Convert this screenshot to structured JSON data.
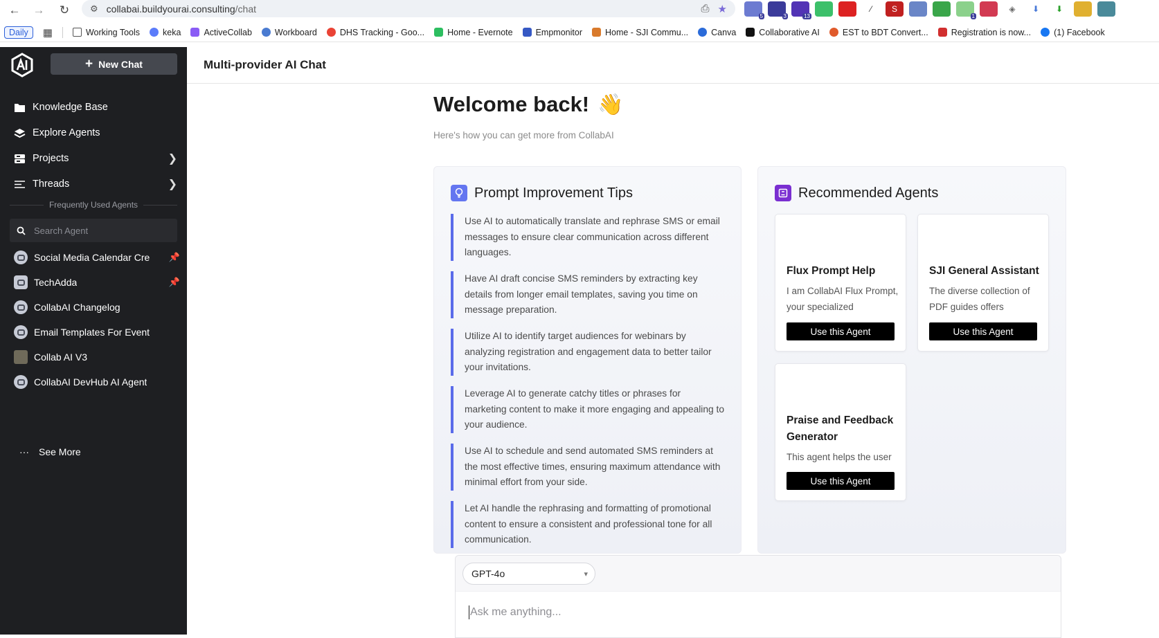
{
  "browser": {
    "url_host": "collabai.buildyourai.consulting",
    "url_path": "/chat",
    "extension_badges": [
      "5",
      "3",
      "13",
      "1"
    ],
    "bookmarks": [
      {
        "label": "Daily"
      },
      {
        "label": "Working Tools",
        "color": "#555555"
      },
      {
        "label": "keka",
        "color": "#5b7cfa"
      },
      {
        "label": "ActiveCollab",
        "color": "#8a5cf5"
      },
      {
        "label": "Workboard",
        "color": "#4a7bd1"
      },
      {
        "label": "DHS Tracking - Goo...",
        "color": "#ea4335"
      },
      {
        "label": "Home - Evernote",
        "color": "#2dbe60"
      },
      {
        "label": "Empmonitor",
        "color": "#3558c4"
      },
      {
        "label": "Home - SJI Commu...",
        "color": "#d97a2b"
      },
      {
        "label": "Canva",
        "color": "#2b6bd9"
      },
      {
        "label": "Collaborative AI",
        "color": "#111111"
      },
      {
        "label": "EST to BDT Convert...",
        "color": "#e05a2b"
      },
      {
        "label": "Registration is now...",
        "color": "#d12f2f"
      },
      {
        "label": "(1) Facebook",
        "color": "#1877f2"
      }
    ]
  },
  "sidebar": {
    "new_chat_label": "New Chat",
    "nav": [
      {
        "label": "Knowledge Base",
        "icon": "folder-icon"
      },
      {
        "label": "Explore Agents",
        "icon": "layers-icon"
      },
      {
        "label": "Projects",
        "icon": "projects-icon"
      },
      {
        "label": "Threads",
        "icon": "threads-icon"
      }
    ],
    "frequent_label": "Frequently Used Agents",
    "search_placeholder": "Search Agent",
    "agents": [
      {
        "name": "Social Media Calendar Cre",
        "pinned": true
      },
      {
        "name": "TechAdda",
        "pinned": true
      },
      {
        "name": "CollabAI Changelog",
        "pinned": false
      },
      {
        "name": "Email Templates For Event",
        "pinned": false
      },
      {
        "name": "Collab AI V3",
        "pinned": false
      },
      {
        "name": "CollabAI DevHub AI Agent",
        "pinned": false
      }
    ],
    "see_more_label": "See More"
  },
  "header": {
    "title": "Multi-provider AI Chat"
  },
  "main": {
    "welcome": "Welcome back!",
    "welcome_emoji": "👋",
    "subtitle": "Here's how you can get more from CollabAI",
    "tips_title": "Prompt Improvement Tips",
    "tips": [
      "Use AI to automatically translate and rephrase SMS or email messages to ensure clear communication across different languages.",
      "Have AI draft concise SMS reminders by extracting key details from longer email templates, saving you time on message preparation.",
      "Utilize AI to identify target audiences for webinars by analyzing registration and engagement data to better tailor your invitations.",
      "Leverage AI to generate catchy titles or phrases for marketing content to make it more engaging and appealing to your audience.",
      "Use AI to schedule and send automated SMS reminders at the most effective times, ensuring maximum attendance with minimal effort from your side.",
      "Let AI handle the rephrasing and formatting of promotional content to ensure a consistent and professional tone for all communication."
    ],
    "agents_title": "Recommended Agents",
    "recommended": [
      {
        "name": "Flux Prompt Help",
        "desc": "I am CollabAI Flux Prompt, your specialized",
        "button": "Use this Agent"
      },
      {
        "name": "SJI General Assistant",
        "desc": "The diverse collection of PDF guides offers",
        "button": "Use this Agent"
      },
      {
        "name": "Praise and Feedback Generator",
        "desc": "This agent helps the user",
        "button": "Use this Agent"
      }
    ]
  },
  "composer": {
    "model": "GPT-4o",
    "placeholder": "Ask me anything..."
  },
  "colors": {
    "sidebar_bg": "#1e1f22",
    "accent": "#5a6bea",
    "tips_icon": "#6476f0",
    "agents_icon": "#7a2fd1",
    "pin": "#5d84ff"
  }
}
